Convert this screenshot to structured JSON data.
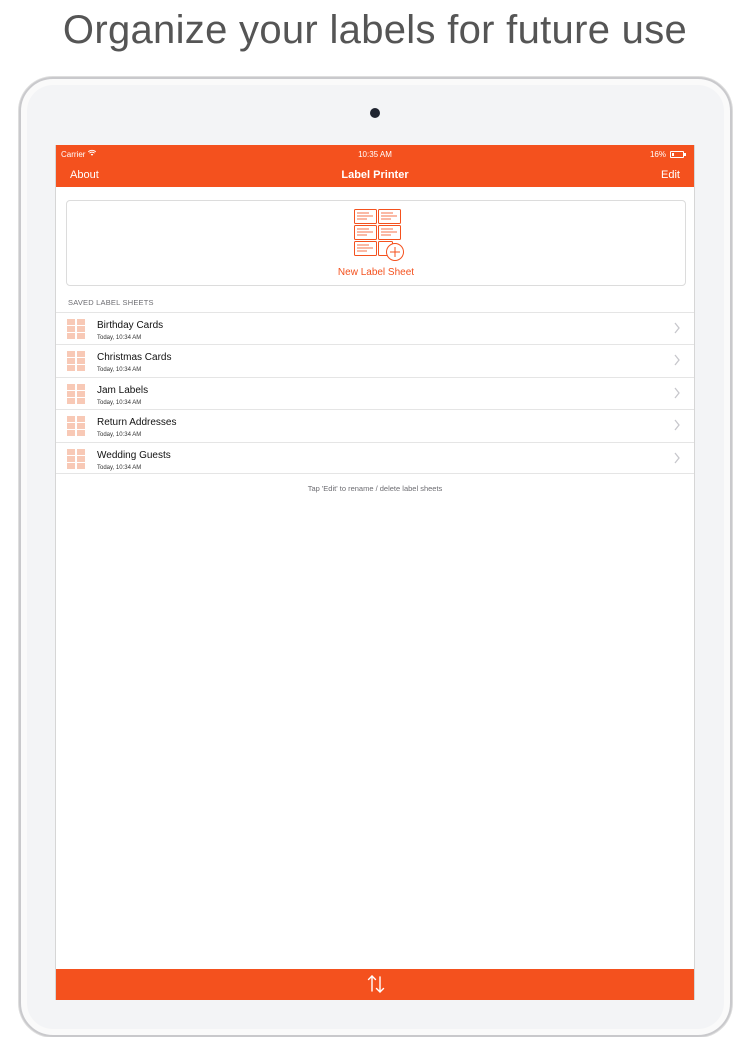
{
  "headline": "Organize your labels for future use",
  "status_bar": {
    "carrier": "Carrier",
    "time": "10:35 AM",
    "battery": "16%",
    "battery_level": 0.16
  },
  "nav": {
    "left_button": "About",
    "title": "Label Printer",
    "right_button": "Edit"
  },
  "new_sheet": {
    "label": "New Label Sheet",
    "icon": "label-sheet-add-icon"
  },
  "section_header": "SAVED LABEL SHEETS",
  "saved_sheets": [
    {
      "name": "Birthday Cards",
      "date": "Today, 10:34 AM"
    },
    {
      "name": "Christmas Cards",
      "date": "Today, 10:34 AM"
    },
    {
      "name": "Jam Labels",
      "date": "Today, 10:34 AM"
    },
    {
      "name": "Return Addresses",
      "date": "Today, 10:34 AM"
    },
    {
      "name": "Wedding Guests",
      "date": "Today, 10:34 AM"
    }
  ],
  "footer_hint": "Tap 'Edit' to rename / delete label sheets",
  "colors": {
    "accent": "#f4511e",
    "background": "#ffffff",
    "thumbnail": "#f8c9b6"
  },
  "toolbar": {
    "sort_icon": "sort-arrows-icon"
  }
}
